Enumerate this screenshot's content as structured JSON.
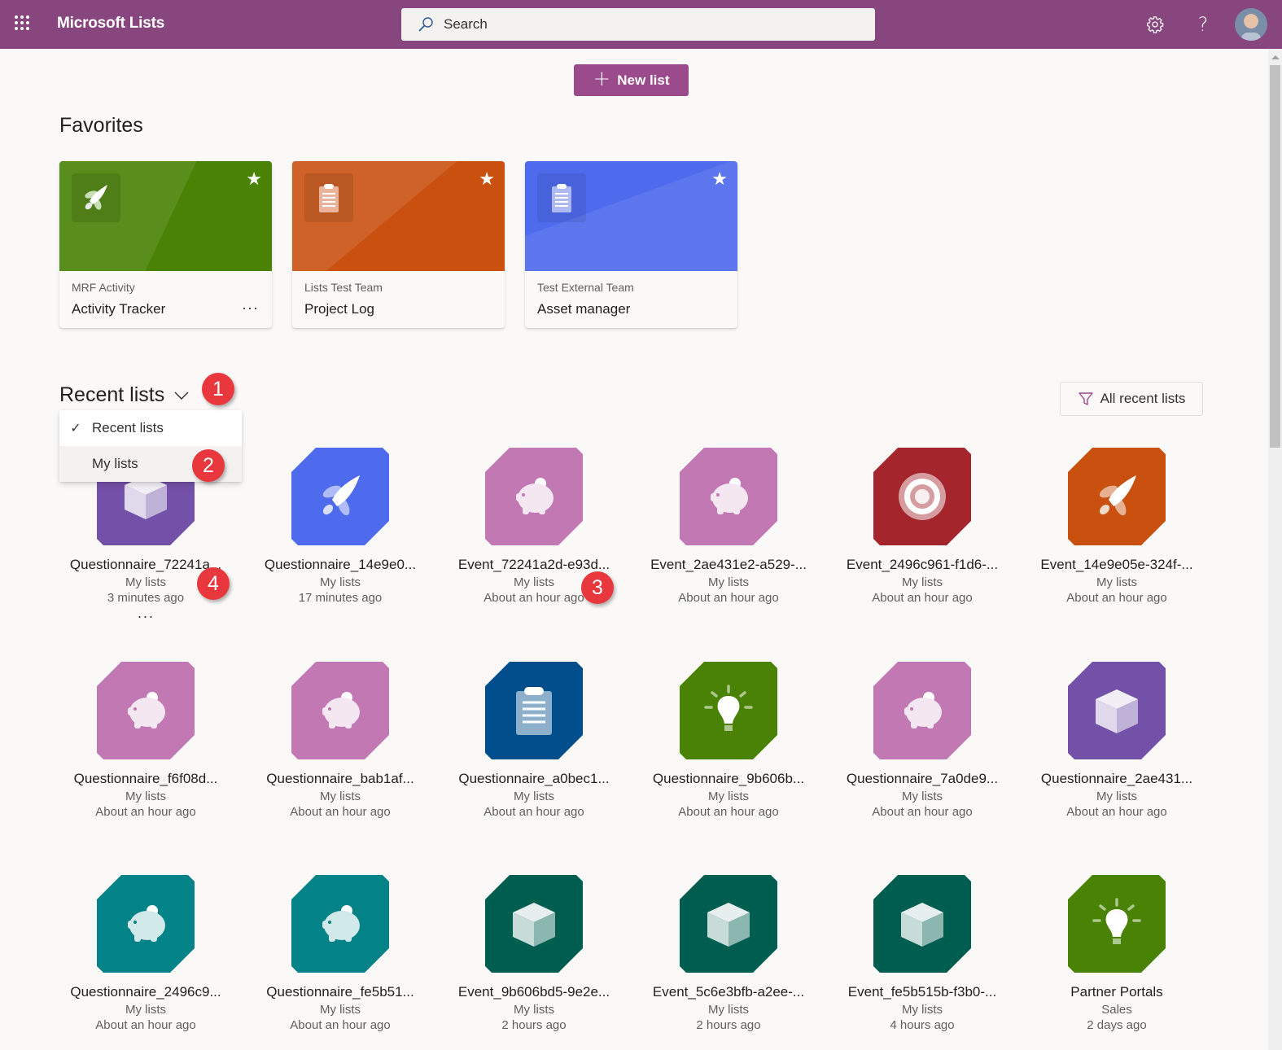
{
  "header": {
    "app_title": "Microsoft Lists",
    "search_placeholder": "Search",
    "icons": [
      "waffle-icon",
      "search-icon",
      "gear-icon",
      "help-icon",
      "avatar"
    ],
    "help_glyph": "?",
    "brand_color": "#87467d"
  },
  "actions": {
    "new_list_label": "New list",
    "new_list_glyph": "+",
    "new_list_color": "#9b4a8b"
  },
  "favorites": {
    "title": "Favorites",
    "star_glyph": "★",
    "more_glyph": "···",
    "items": [
      {
        "location": "MRF Activity",
        "name": "Activity Tracker",
        "icon": "rocket",
        "color": "#498205",
        "show_more": true
      },
      {
        "location": "Lists Test Team",
        "name": "Project Log",
        "icon": "clipboard",
        "color": "#ca5010",
        "show_more": false
      },
      {
        "location": "Test External Team",
        "name": "Asset manager",
        "icon": "clipboard",
        "color": "#4f6bed",
        "show_more": false
      }
    ]
  },
  "recent": {
    "title": "Recent lists",
    "filter_label": "All recent lists",
    "dropdown": {
      "check_glyph": "✓",
      "options": [
        {
          "label": "Recent lists",
          "selected": true
        },
        {
          "label": "My lists",
          "selected": false,
          "hovered": true
        }
      ]
    },
    "more_glyph": "···",
    "items": [
      {
        "name": "Questionnaire_72241a...",
        "location": "My lists",
        "time": "3 minutes ago",
        "icon": "cube",
        "color": "#7451a8",
        "show_more": true
      },
      {
        "name": "Questionnaire_14e9e0...",
        "location": "My lists",
        "time": "17 minutes ago",
        "icon": "rocket",
        "color": "#4f6bed"
      },
      {
        "name": "Event_72241a2d-e93d...",
        "location": "My lists",
        "time": "About an hour ago",
        "icon": "piggy",
        "color": "#c278b3"
      },
      {
        "name": "Event_2ae431e2-a529-...",
        "location": "My lists",
        "time": "About an hour ago",
        "icon": "piggy",
        "color": "#c278b3"
      },
      {
        "name": "Event_2496c961-f1d6-...",
        "location": "My lists",
        "time": "About an hour ago",
        "icon": "target",
        "color": "#a4262c"
      },
      {
        "name": "Event_14e9e05e-324f-...",
        "location": "My lists",
        "time": "About an hour ago",
        "icon": "rocket",
        "color": "#ca5010"
      },
      {
        "name": "Questionnaire_f6f08d...",
        "location": "My lists",
        "time": "About an hour ago",
        "icon": "piggy",
        "color": "#c278b3"
      },
      {
        "name": "Questionnaire_bab1af...",
        "location": "My lists",
        "time": "About an hour ago",
        "icon": "piggy",
        "color": "#c278b3"
      },
      {
        "name": "Questionnaire_a0bec1...",
        "location": "My lists",
        "time": "About an hour ago",
        "icon": "clipboard",
        "color": "#004e8c"
      },
      {
        "name": "Questionnaire_9b606b...",
        "location": "My lists",
        "time": "About an hour ago",
        "icon": "bulb",
        "color": "#498205"
      },
      {
        "name": "Questionnaire_7a0de9...",
        "location": "My lists",
        "time": "About an hour ago",
        "icon": "piggy",
        "color": "#c278b3"
      },
      {
        "name": "Questionnaire_2ae431...",
        "location": "My lists",
        "time": "About an hour ago",
        "icon": "cube",
        "color": "#7451a8"
      },
      {
        "name": "Questionnaire_2496c9...",
        "location": "My lists",
        "time": "About an hour ago",
        "icon": "piggy",
        "color": "#038387"
      },
      {
        "name": "Questionnaire_fe5b51...",
        "location": "My lists",
        "time": "About an hour ago",
        "icon": "piggy",
        "color": "#038387"
      },
      {
        "name": "Event_9b606bd5-9e2e...",
        "location": "My lists",
        "time": "2 hours ago",
        "icon": "cube",
        "color": "#005e50"
      },
      {
        "name": "Event_5c6e3bfb-a2ee-...",
        "location": "My lists",
        "time": "2 hours ago",
        "icon": "cube",
        "color": "#005e50"
      },
      {
        "name": "Event_fe5b515b-f3b0-...",
        "location": "My lists",
        "time": "4 hours ago",
        "icon": "cube",
        "color": "#005e50"
      },
      {
        "name": "Partner Portals",
        "location": "Sales",
        "time": "2 days ago",
        "icon": "bulb",
        "color": "#498205"
      }
    ]
  },
  "annotations": {
    "color": "#e8383d",
    "badges": [
      "1",
      "2",
      "3",
      "4"
    ]
  }
}
